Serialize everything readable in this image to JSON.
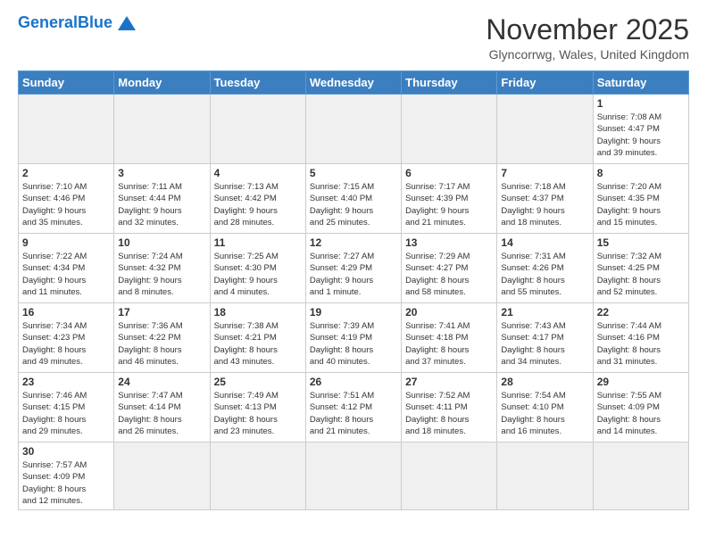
{
  "header": {
    "logo_general": "General",
    "logo_blue": "Blue",
    "month_title": "November 2025",
    "location": "Glyncorrwg, Wales, United Kingdom"
  },
  "weekdays": [
    "Sunday",
    "Monday",
    "Tuesday",
    "Wednesday",
    "Thursday",
    "Friday",
    "Saturday"
  ],
  "weeks": [
    [
      {
        "day": "",
        "info": "",
        "empty": true
      },
      {
        "day": "",
        "info": "",
        "empty": true
      },
      {
        "day": "",
        "info": "",
        "empty": true
      },
      {
        "day": "",
        "info": "",
        "empty": true
      },
      {
        "day": "",
        "info": "",
        "empty": true
      },
      {
        "day": "",
        "info": "",
        "empty": true
      },
      {
        "day": "1",
        "info": "Sunrise: 7:08 AM\nSunset: 4:47 PM\nDaylight: 9 hours\nand 39 minutes."
      }
    ],
    [
      {
        "day": "2",
        "info": "Sunrise: 7:10 AM\nSunset: 4:46 PM\nDaylight: 9 hours\nand 35 minutes."
      },
      {
        "day": "3",
        "info": "Sunrise: 7:11 AM\nSunset: 4:44 PM\nDaylight: 9 hours\nand 32 minutes."
      },
      {
        "day": "4",
        "info": "Sunrise: 7:13 AM\nSunset: 4:42 PM\nDaylight: 9 hours\nand 28 minutes."
      },
      {
        "day": "5",
        "info": "Sunrise: 7:15 AM\nSunset: 4:40 PM\nDaylight: 9 hours\nand 25 minutes."
      },
      {
        "day": "6",
        "info": "Sunrise: 7:17 AM\nSunset: 4:39 PM\nDaylight: 9 hours\nand 21 minutes."
      },
      {
        "day": "7",
        "info": "Sunrise: 7:18 AM\nSunset: 4:37 PM\nDaylight: 9 hours\nand 18 minutes."
      },
      {
        "day": "8",
        "info": "Sunrise: 7:20 AM\nSunset: 4:35 PM\nDaylight: 9 hours\nand 15 minutes."
      }
    ],
    [
      {
        "day": "9",
        "info": "Sunrise: 7:22 AM\nSunset: 4:34 PM\nDaylight: 9 hours\nand 11 minutes."
      },
      {
        "day": "10",
        "info": "Sunrise: 7:24 AM\nSunset: 4:32 PM\nDaylight: 9 hours\nand 8 minutes."
      },
      {
        "day": "11",
        "info": "Sunrise: 7:25 AM\nSunset: 4:30 PM\nDaylight: 9 hours\nand 4 minutes."
      },
      {
        "day": "12",
        "info": "Sunrise: 7:27 AM\nSunset: 4:29 PM\nDaylight: 9 hours\nand 1 minute."
      },
      {
        "day": "13",
        "info": "Sunrise: 7:29 AM\nSunset: 4:27 PM\nDaylight: 8 hours\nand 58 minutes."
      },
      {
        "day": "14",
        "info": "Sunrise: 7:31 AM\nSunset: 4:26 PM\nDaylight: 8 hours\nand 55 minutes."
      },
      {
        "day": "15",
        "info": "Sunrise: 7:32 AM\nSunset: 4:25 PM\nDaylight: 8 hours\nand 52 minutes."
      }
    ],
    [
      {
        "day": "16",
        "info": "Sunrise: 7:34 AM\nSunset: 4:23 PM\nDaylight: 8 hours\nand 49 minutes."
      },
      {
        "day": "17",
        "info": "Sunrise: 7:36 AM\nSunset: 4:22 PM\nDaylight: 8 hours\nand 46 minutes."
      },
      {
        "day": "18",
        "info": "Sunrise: 7:38 AM\nSunset: 4:21 PM\nDaylight: 8 hours\nand 43 minutes."
      },
      {
        "day": "19",
        "info": "Sunrise: 7:39 AM\nSunset: 4:19 PM\nDaylight: 8 hours\nand 40 minutes."
      },
      {
        "day": "20",
        "info": "Sunrise: 7:41 AM\nSunset: 4:18 PM\nDaylight: 8 hours\nand 37 minutes."
      },
      {
        "day": "21",
        "info": "Sunrise: 7:43 AM\nSunset: 4:17 PM\nDaylight: 8 hours\nand 34 minutes."
      },
      {
        "day": "22",
        "info": "Sunrise: 7:44 AM\nSunset: 4:16 PM\nDaylight: 8 hours\nand 31 minutes."
      }
    ],
    [
      {
        "day": "23",
        "info": "Sunrise: 7:46 AM\nSunset: 4:15 PM\nDaylight: 8 hours\nand 29 minutes."
      },
      {
        "day": "24",
        "info": "Sunrise: 7:47 AM\nSunset: 4:14 PM\nDaylight: 8 hours\nand 26 minutes."
      },
      {
        "day": "25",
        "info": "Sunrise: 7:49 AM\nSunset: 4:13 PM\nDaylight: 8 hours\nand 23 minutes."
      },
      {
        "day": "26",
        "info": "Sunrise: 7:51 AM\nSunset: 4:12 PM\nDaylight: 8 hours\nand 21 minutes."
      },
      {
        "day": "27",
        "info": "Sunrise: 7:52 AM\nSunset: 4:11 PM\nDaylight: 8 hours\nand 18 minutes."
      },
      {
        "day": "28",
        "info": "Sunrise: 7:54 AM\nSunset: 4:10 PM\nDaylight: 8 hours\nand 16 minutes."
      },
      {
        "day": "29",
        "info": "Sunrise: 7:55 AM\nSunset: 4:09 PM\nDaylight: 8 hours\nand 14 minutes."
      }
    ],
    [
      {
        "day": "30",
        "info": "Sunrise: 7:57 AM\nSunset: 4:09 PM\nDaylight: 8 hours\nand 12 minutes."
      },
      {
        "day": "",
        "info": "",
        "empty": true
      },
      {
        "day": "",
        "info": "",
        "empty": true
      },
      {
        "day": "",
        "info": "",
        "empty": true
      },
      {
        "day": "",
        "info": "",
        "empty": true
      },
      {
        "day": "",
        "info": "",
        "empty": true
      },
      {
        "day": "",
        "info": "",
        "empty": true
      }
    ]
  ]
}
